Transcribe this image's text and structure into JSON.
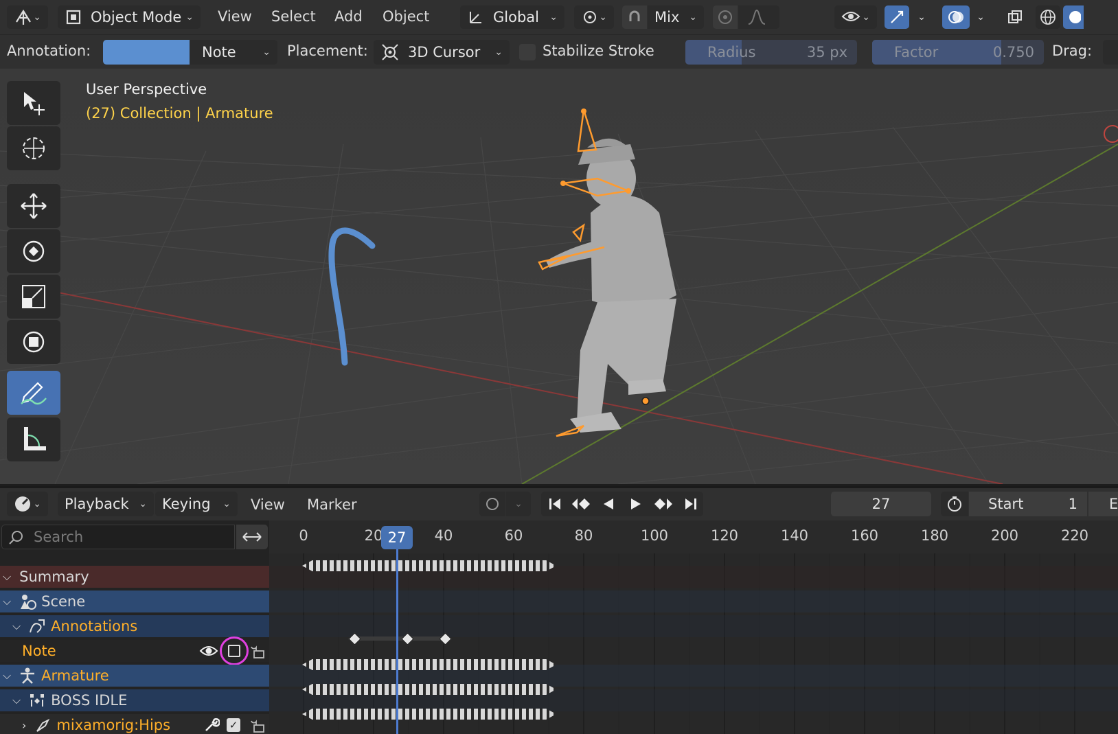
{
  "header": {
    "mode": "Object Mode",
    "menus": [
      "View",
      "Select",
      "Add",
      "Object"
    ],
    "orientation": "Global",
    "snap_mode": "Mix"
  },
  "tool_settings": {
    "annotation_label": "Annotation:",
    "layer": "Note",
    "layer_color": "#5b8fd0",
    "placement_label": "Placement:",
    "placement": "3D Cursor",
    "stabilize_label": "Stabilize Stroke",
    "radius_label": "Radius",
    "radius_value": "35 px",
    "factor_label": "Factor",
    "factor_value": "0.750",
    "drag_label": "Drag:"
  },
  "viewport": {
    "perspective": "User Perspective",
    "collection_info": "(27) Collection | Armature",
    "annotation_color": "#5b8fd0",
    "armature_color": "#ff9b2e"
  },
  "tools": [
    "select-box",
    "cursor",
    "move",
    "rotate",
    "scale",
    "transform",
    "annotate",
    "measure"
  ],
  "timeline": {
    "menus": [
      "Playback",
      "Keying",
      "View",
      "Marker"
    ],
    "current_frame": "27",
    "start_label": "Start",
    "start_value": "1",
    "end_label_partial": "E",
    "search_placeholder": "Search",
    "ruler": [
      "0",
      "20",
      "40",
      "60",
      "80",
      "100",
      "120",
      "140",
      "160",
      "180",
      "200",
      "220"
    ],
    "playhead_label": "27"
  },
  "channels": [
    {
      "name": "Summary",
      "type": "summary"
    },
    {
      "name": "Scene",
      "type": "scene"
    },
    {
      "name": "Annotations",
      "type": "annotations"
    },
    {
      "name": "Note",
      "type": "layer"
    },
    {
      "name": "Armature",
      "type": "object"
    },
    {
      "name": "BOSS IDLE",
      "type": "action"
    },
    {
      "name": "mixamorig:Hips",
      "type": "group"
    }
  ],
  "colors": {
    "accent": "#4772b3",
    "orange_text": "#ffaf29",
    "summary_bg": "#4a2a2a",
    "scene_bg": "#2d4a73",
    "highlight_ring": "#e040e0"
  }
}
